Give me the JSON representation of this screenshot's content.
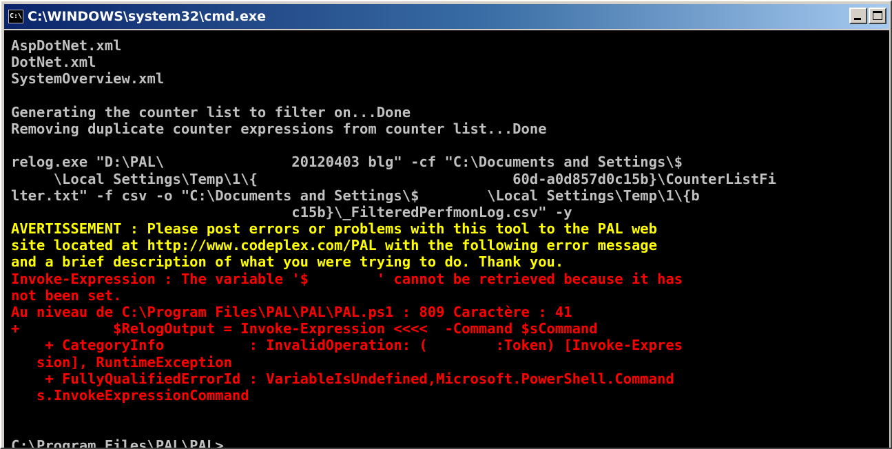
{
  "window": {
    "title": "C:\\WINDOWS\\system32\\cmd.exe",
    "icon": "cmd-icon",
    "icon_text": "C:\\"
  },
  "colors": {
    "console_background": "#000000",
    "default_text": "#c0c0c0",
    "warning_text": "#ffff00",
    "error_text": "#ff0000"
  },
  "console": {
    "lines": [
      {
        "text": "AspDotNet.xml",
        "color": "gray"
      },
      {
        "text": "DotNet.xml",
        "color": "gray"
      },
      {
        "text": "SystemOverview.xml",
        "color": "gray"
      },
      {
        "text": "",
        "color": "gray"
      },
      {
        "text": "Generating the counter list to filter on...Done",
        "color": "gray"
      },
      {
        "text": "Removing duplicate counter expressions from counter list...Done",
        "color": "gray"
      },
      {
        "text": "",
        "color": "gray"
      },
      {
        "text": "relog.exe \"D:\\PAL\\               20120403 blg\" -cf \"C:\\Documents and Settings\\$  ",
        "color": "gray"
      },
      {
        "text": "     \\Local Settings\\Temp\\1\\{                              60d-a0d857d0c15b}\\CounterListFi",
        "color": "gray"
      },
      {
        "text": "lter.txt\" -f csv -o \"C:\\Documents and Settings\\$        \\Local Settings\\Temp\\1\\{b",
        "color": "gray"
      },
      {
        "text": "                                 c15b}\\_FilteredPerfmonLog.csv\" -y",
        "color": "gray"
      },
      {
        "text": "AVERTISSEMENT : Please post errors or problems with this tool to the PAL web",
        "color": "yellow"
      },
      {
        "text": "site located at http://www.codeplex.com/PAL with the following error message",
        "color": "yellow"
      },
      {
        "text": "and a brief description of what you were trying to do. Thank you.",
        "color": "yellow"
      },
      {
        "text": "Invoke-Expression : The variable '$        ' cannot be retrieved because it has",
        "color": "red"
      },
      {
        "text": "not been set.",
        "color": "red"
      },
      {
        "text": "Au niveau de C:\\Program Files\\PAL\\PAL\\PAL.ps1 : 809 Caractère : 41",
        "color": "red"
      },
      {
        "text": "+           $RelogOutput = Invoke-Expression <<<<  -Command $sCommand",
        "color": "red"
      },
      {
        "text": "    + CategoryInfo          : InvalidOperation: (        :Token) [Invoke-Expres",
        "color": "red"
      },
      {
        "text": "   sion], RuntimeException",
        "color": "red"
      },
      {
        "text": "    + FullyQualifiedErrorId : VariableIsUndefined,Microsoft.PowerShell.Command",
        "color": "red"
      },
      {
        "text": "   s.InvokeExpressionCommand",
        "color": "red"
      },
      {
        "text": "",
        "color": "gray"
      },
      {
        "text": "",
        "color": "gray"
      },
      {
        "text": "C:\\Program Files\\PAL\\PAL>",
        "color": "gray"
      }
    ]
  }
}
